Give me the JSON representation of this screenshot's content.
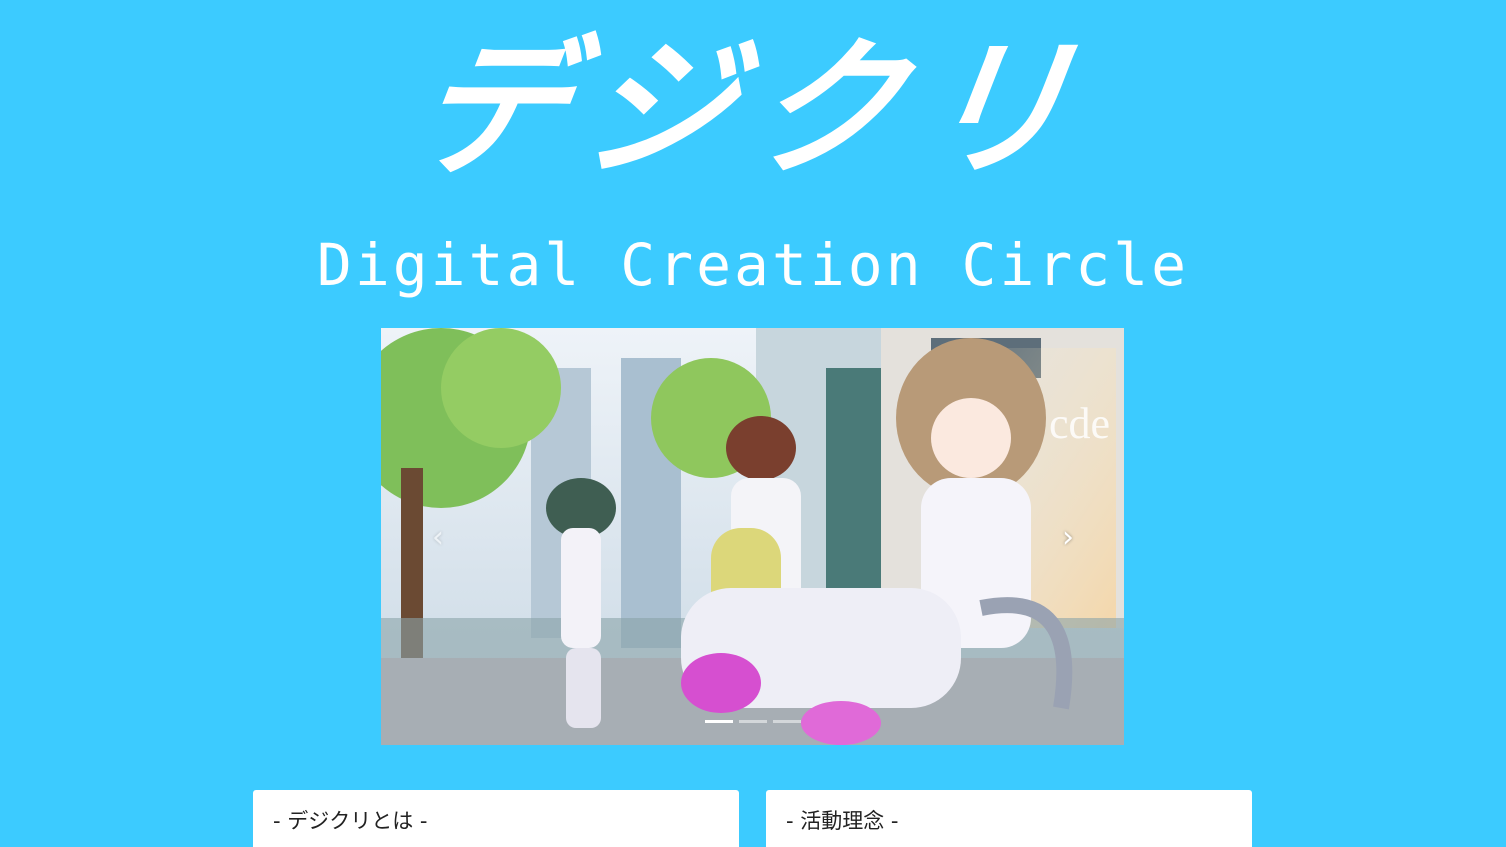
{
  "header": {
    "logo_jp": "デジクリ",
    "logo_en": "Digital Creation Circle"
  },
  "carousel": {
    "prev_icon": "chevron-left-icon",
    "next_icon": "chevron-right-icon",
    "prev_label": "‹",
    "next_label": "›",
    "slide_count": 3,
    "active_index": 0,
    "slide_text": "cde"
  },
  "cards": [
    {
      "title": "- デジクリとは -"
    },
    {
      "title": "- 活動理念 -"
    }
  ],
  "colors": {
    "background": "#3ccbff",
    "card": "#ffffff",
    "text": "#222222"
  }
}
